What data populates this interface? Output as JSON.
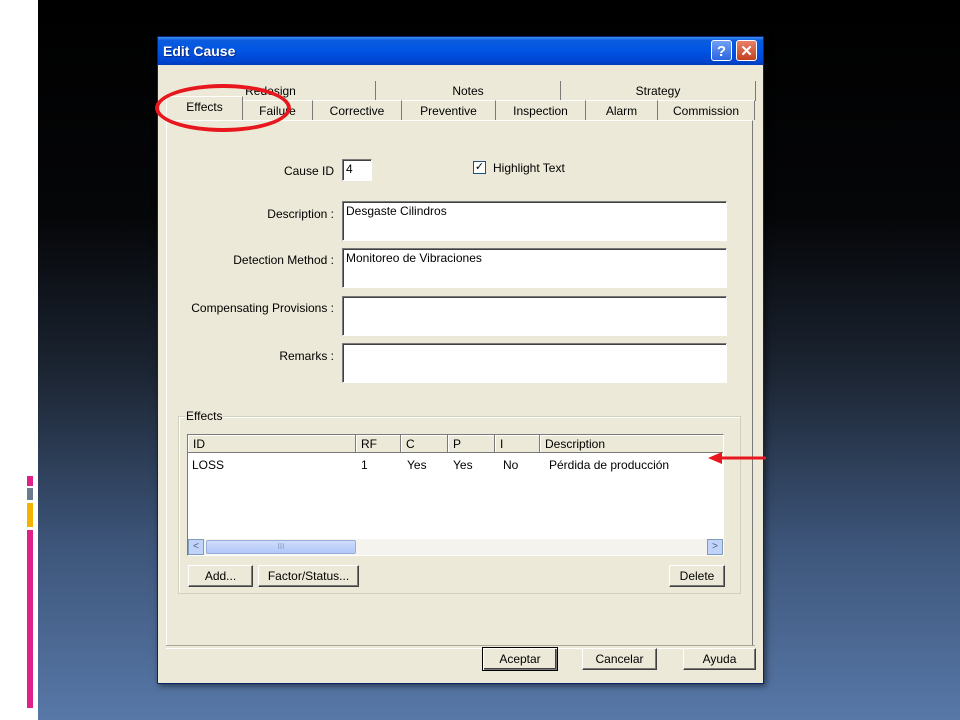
{
  "window": {
    "title": "Edit Cause",
    "help_glyph": "?",
    "close_glyph": "✕"
  },
  "tabs": {
    "back_row": [
      "Redesign",
      "Notes",
      "Strategy"
    ],
    "front_row": [
      "Effects",
      "Failure",
      "Corrective",
      "Preventive",
      "Inspection",
      "Alarm",
      "Commission"
    ],
    "active": "Effects"
  },
  "form": {
    "cause_id_label": "Cause ID",
    "cause_id_value": "4",
    "highlight_label": "Highlight Text",
    "highlight_checked": true,
    "description_label": "Description :",
    "description_value": "Desgaste Cilindros",
    "detection_label": "Detection Method :",
    "detection_value": "Monitoreo de Vibraciones",
    "compensating_label": "Compensating Provisions :",
    "compensating_value": "",
    "remarks_label": "Remarks :",
    "remarks_value": ""
  },
  "effects": {
    "group_title": "Effects",
    "columns": [
      "ID",
      "RF",
      "C",
      "P",
      "I",
      "Description"
    ],
    "rows": [
      {
        "id": "LOSS",
        "rf": "1",
        "c": "Yes",
        "p": "Yes",
        "i": "No",
        "description": "Pérdida de producción"
      }
    ],
    "scroll_left": "<",
    "scroll_right": ">",
    "scroll_grip": "III"
  },
  "buttons": {
    "add": "Add...",
    "factor": "Factor/Status...",
    "delete": "Delete",
    "accept": "Aceptar",
    "cancel": "Cancelar",
    "help": "Ayuda"
  },
  "colors": {
    "annotation": "#e8171d",
    "title_bar": "#0054e3",
    "dialog": "#ece9d8"
  }
}
